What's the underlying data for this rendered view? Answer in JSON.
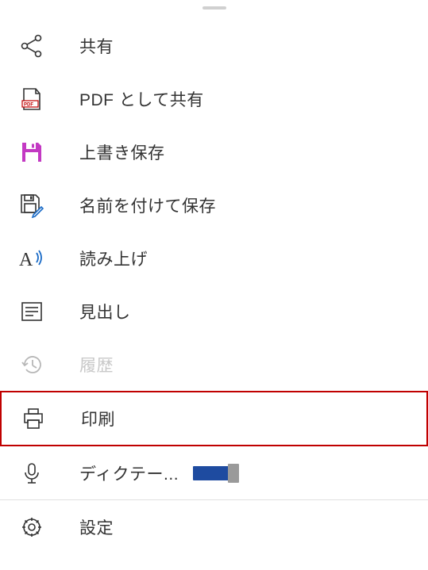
{
  "menu": {
    "items": [
      {
        "label": "共有"
      },
      {
        "label": "PDF として共有"
      },
      {
        "label": "上書き保存"
      },
      {
        "label": "名前を付けて保存"
      },
      {
        "label": "読み上げ"
      },
      {
        "label": "見出し"
      },
      {
        "label": "履歴"
      },
      {
        "label": "印刷"
      },
      {
        "label": "ディクテー..."
      },
      {
        "label": "設定"
      }
    ]
  }
}
